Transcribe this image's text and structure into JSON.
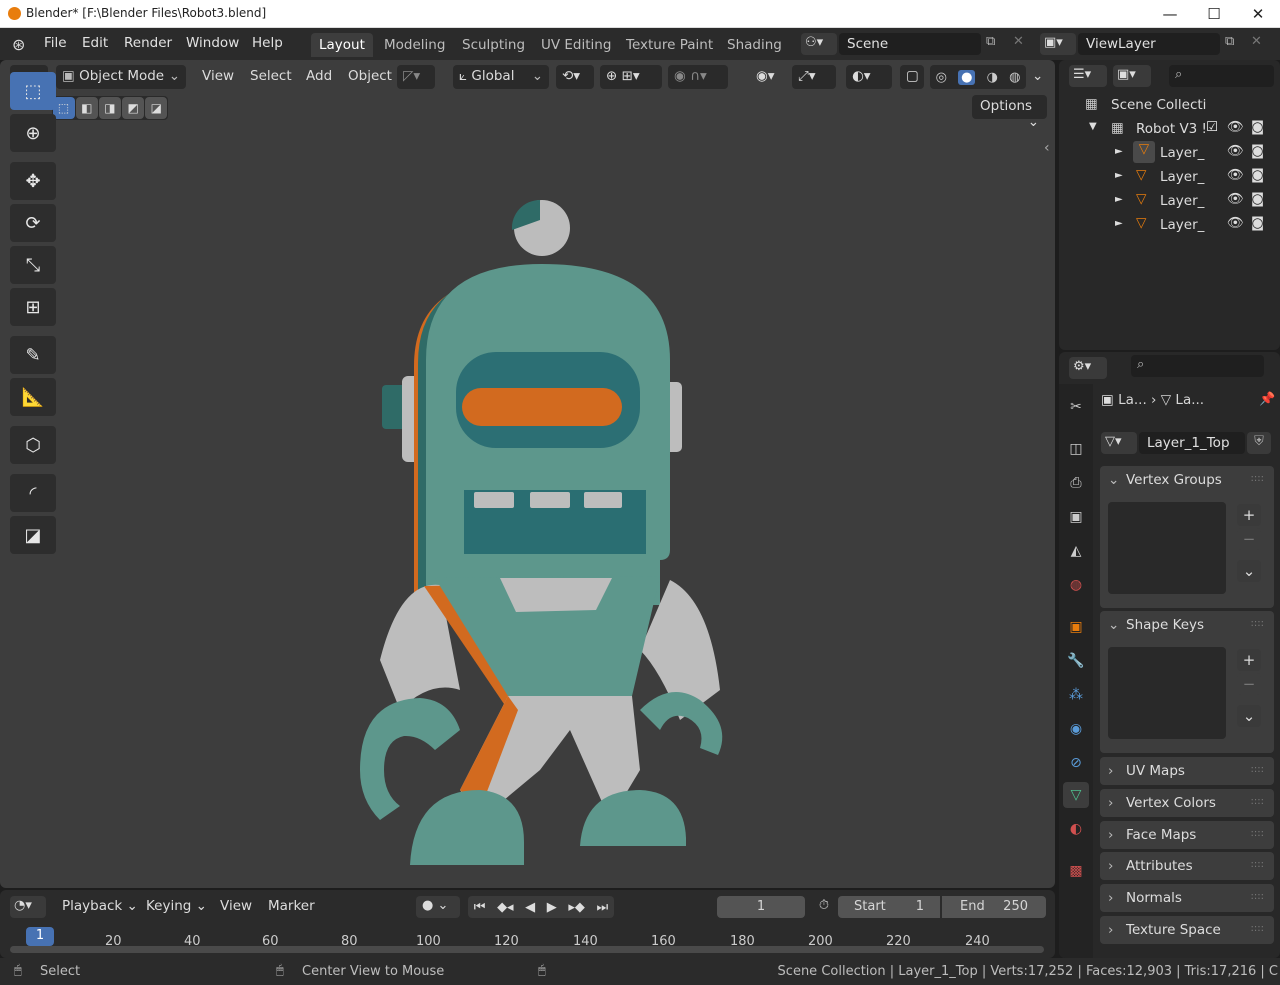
{
  "window": {
    "title": "Blender* [F:\\Blender Files\\Robot3.blend]",
    "minimize": "—",
    "maximize": "☐",
    "close": "✕"
  },
  "menu": {
    "items": [
      "File",
      "Edit",
      "Render",
      "Window",
      "Help"
    ]
  },
  "workspaces": {
    "tabs": [
      "Layout",
      "Modeling",
      "Sculpting",
      "UV Editing",
      "Texture Paint",
      "Shading"
    ],
    "active": "Layout"
  },
  "scene": {
    "name": "Scene"
  },
  "view_layer": {
    "name": "ViewLayer"
  },
  "viewport_header": {
    "mode": "Object Mode",
    "view": "View",
    "select": "Select",
    "add": "Add",
    "object": "Object",
    "transform_orientation": "Global",
    "options": "Options"
  },
  "outliner": {
    "root": "Scene Collecti",
    "collection": "Robot V3 !",
    "objects": [
      "Layer_",
      "Layer_",
      "Layer_",
      "Layer_"
    ]
  },
  "properties": {
    "breadcrumb": [
      "La...",
      "La..."
    ],
    "mesh_name": "Layer_1_Top",
    "panels": [
      "Vertex Groups",
      "Shape Keys",
      "UV Maps",
      "Vertex Colors",
      "Face Maps",
      "Attributes",
      "Normals",
      "Texture Space"
    ]
  },
  "timeline": {
    "playback": "Playback",
    "keying": "Keying",
    "view": "View",
    "marker": "Marker",
    "current_frame": "1",
    "start_label": "Start",
    "start_value": "1",
    "end_label": "End",
    "end_value": "250",
    "frame_marks": [
      "20",
      "40",
      "60",
      "80",
      "100",
      "120",
      "140",
      "160",
      "180",
      "200",
      "220",
      "240"
    ]
  },
  "statusbar": {
    "left_action": "Select",
    "middle_action": "Center View to Mouse",
    "info": "Scene Collection | Layer_1_Top | Verts:17,252 | Faces:12,903 | Tris:17,216 | C"
  },
  "colors": {
    "accent": "#4772b3",
    "robot_teal": "#5d978c",
    "robot_orange": "#d26a1f",
    "robot_grey": "#bdbdbd"
  }
}
